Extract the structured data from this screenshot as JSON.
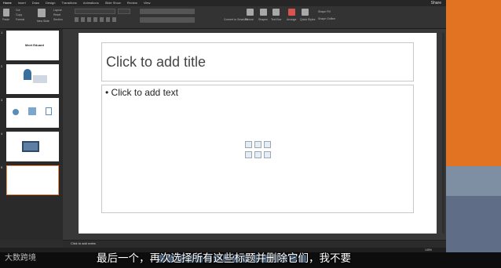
{
  "menu": {
    "tabs": [
      "Home",
      "Insert",
      "Draw",
      "Design",
      "Transitions",
      "Animations",
      "Slide Show",
      "Review",
      "View"
    ],
    "share_label": "Share"
  },
  "ribbon": {
    "paste": "Paste",
    "cut": "Cut",
    "copy": "Copy",
    "format": "Format",
    "new_slide": "New Slide",
    "layout": "Layout",
    "reset": "Reset",
    "section": "Section",
    "picture": "Picture",
    "shapes": "Shapes",
    "text_box": "Text Box",
    "arrange": "Arrange",
    "quick_styles": "Quick Styles",
    "shape_fill": "Shape Fill",
    "shape_outline": "Shape Outline",
    "convert_smartart": "Convert to SmartArt"
  },
  "thumbnails": [
    {
      "num": "1",
      "text": "Meet Eduard"
    },
    {
      "num": "2",
      "text": ""
    },
    {
      "num": "3",
      "text": ""
    },
    {
      "num": "4",
      "text": ""
    },
    {
      "num": "5",
      "text": ""
    }
  ],
  "slide": {
    "title_placeholder": "Click to add title",
    "body_placeholder": "• Click to add text"
  },
  "notes_placeholder": "Click to add notes",
  "zoom": "145%",
  "subtitle": "最后一个，再次选择所有这些标题并删除它们，我不要",
  "watermark": "大数跨境",
  "colors": {
    "accent": "#f28f4b",
    "desktop": "#e27322"
  }
}
